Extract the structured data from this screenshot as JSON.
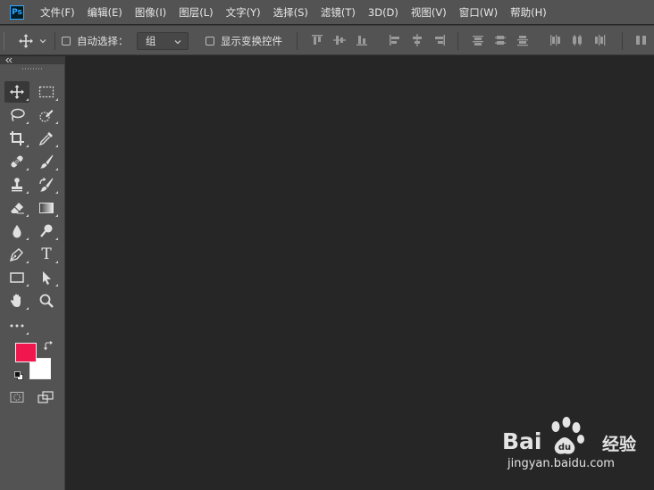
{
  "app": {
    "logo_text": "Ps",
    "accent_color": "#31a8ff",
    "chrome_color": "#535353",
    "canvas_color": "#262626"
  },
  "menubar": {
    "items": [
      {
        "label": "文件(F)"
      },
      {
        "label": "编辑(E)"
      },
      {
        "label": "图像(I)"
      },
      {
        "label": "图层(L)"
      },
      {
        "label": "文字(Y)"
      },
      {
        "label": "选择(S)"
      },
      {
        "label": "滤镜(T)"
      },
      {
        "label": "3D(D)"
      },
      {
        "label": "视图(V)"
      },
      {
        "label": "窗口(W)"
      },
      {
        "label": "帮助(H)"
      }
    ]
  },
  "options": {
    "tool_icon": "move-icon",
    "auto_select_label": "自动选择：",
    "auto_select_checked": false,
    "auto_select_target": "组",
    "show_transform_label": "显示变换控件",
    "show_transform_checked": false
  },
  "tools": [
    [
      "move-icon",
      "rect-marquee-icon"
    ],
    [
      "lasso-icon",
      "quick-selection-icon"
    ],
    [
      "crop-icon",
      "eyedropper-icon"
    ],
    [
      "healing-brush-icon",
      "brush-icon"
    ],
    [
      "clone-stamp-icon",
      "history-brush-icon"
    ],
    [
      "eraser-icon",
      "gradient-icon"
    ],
    [
      "blur-icon",
      "dodge-icon"
    ],
    [
      "pen-icon",
      "type-icon"
    ],
    [
      "rectangle-icon",
      "path-selection-icon"
    ],
    [
      "hand-icon",
      "zoom-icon"
    ],
    [
      "more-tools-icon"
    ]
  ],
  "type_tool_glyph": "T",
  "colors": {
    "foreground": "#f0174f",
    "background": "#ffffff"
  },
  "watermark": {
    "brand_left": "Bai",
    "brand_right": "经验",
    "url": "jingyan.baidu.com"
  }
}
